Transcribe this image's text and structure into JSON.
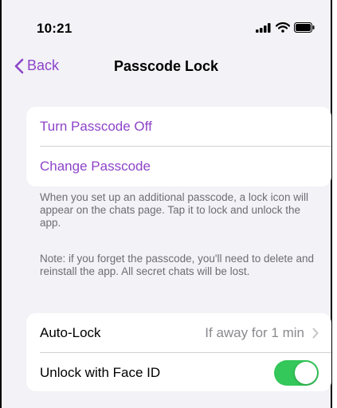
{
  "status_bar": {
    "time": "10:21",
    "icons": [
      "signal-icon",
      "wifi-icon",
      "battery-icon"
    ]
  },
  "nav": {
    "back_label": "Back",
    "title": "Passcode Lock"
  },
  "passcode_group": {
    "items": [
      {
        "label": "Turn Passcode Off"
      },
      {
        "label": "Change Passcode"
      }
    ]
  },
  "footnotes": {
    "info": "When you set up an additional passcode, a lock icon will appear on the chats page. Tap it to lock and unlock the app.",
    "note": "Note: if you forget the passcode, you'll need to delete and reinstall the app. All secret chats will be lost."
  },
  "settings_group": {
    "auto_lock": {
      "label": "Auto-Lock",
      "value": "If away for 1 min"
    },
    "face_id": {
      "label": "Unlock with Face ID",
      "enabled": true
    }
  },
  "colors": {
    "accent": "#8e44c8",
    "toggle_on": "#34c759",
    "background": "#f2f2f7",
    "secondary_text": "#6d6d72"
  }
}
